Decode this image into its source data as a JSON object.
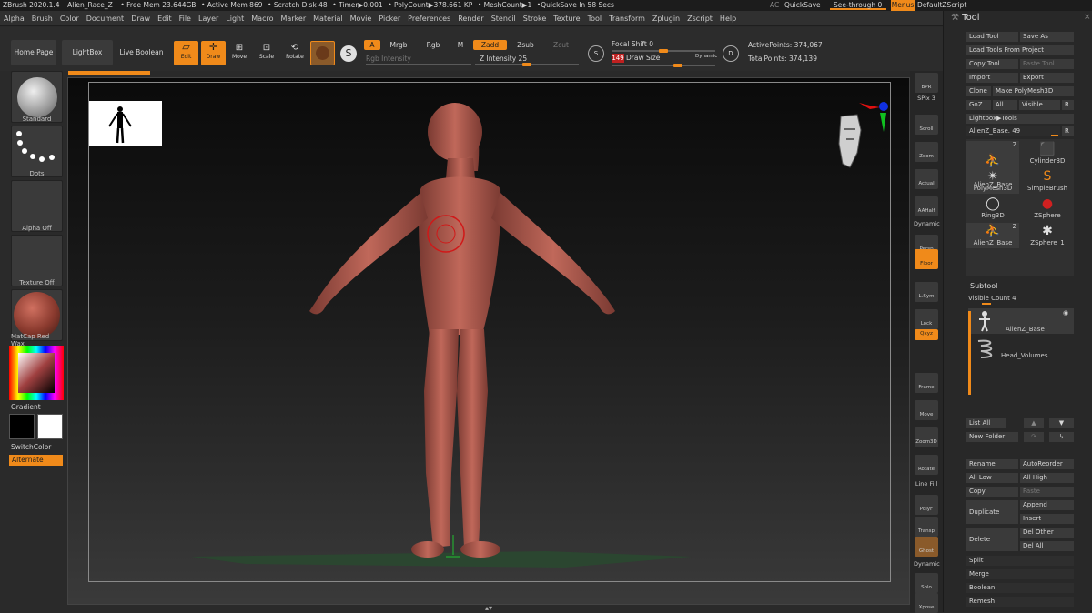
{
  "topbar": {
    "app": "ZBrush 2020.1.4",
    "file": "Alien_Race_Z",
    "free_mem": "• Free Mem 23.644GB",
    "active_mem": "• Active Mem 869",
    "scratch": "• Scratch Disk 48",
    "timer": "• Timer▶0.001",
    "polycount": "• PolyCount▶378.661 KP",
    "meshcount": "• MeshCount▶1",
    "quicksave_in": "•QuickSave In 58 Secs",
    "ac": "AC",
    "quicksave": "QuickSave",
    "see_through": "See-through  0",
    "menus": "Menus",
    "script": "DefaultZScript"
  },
  "menubar": [
    "Alpha",
    "Brush",
    "Color",
    "Document",
    "Draw",
    "Edit",
    "File",
    "Layer",
    "Light",
    "Macro",
    "Marker",
    "Material",
    "Movie",
    "Picker",
    "Preferences",
    "Render",
    "Stencil",
    "Stroke",
    "Texture",
    "Tool",
    "Transform",
    "Zplugin",
    "Zscript",
    "Help"
  ],
  "shelf": {
    "home_page": "Home Page",
    "lightbox": "LightBox",
    "live_boolean": "Live Boolean",
    "edit": "Edit",
    "draw": "Draw",
    "move": "Move",
    "scale": "Scale",
    "rotate": "Rotate",
    "a": "A",
    "mrgb": "Mrgb",
    "rgb": "Rgb",
    "m": "M",
    "zadd": "Zadd",
    "zsub": "Zsub",
    "zcut": "Zcut",
    "rgb_intensity": "Rgb Intensity",
    "z_intensity": "Z Intensity 25",
    "z_intensity_value": 25,
    "focal_shift": "Focal Shift 0",
    "draw_size_value": "149",
    "draw_size": "Draw Size",
    "dynamic": "Dynamic",
    "active_points": "ActivePoints: 374,067",
    "total_points": "TotalPoints: 374,139"
  },
  "lefttray": {
    "standard": "Standard",
    "dots": "Dots",
    "alpha_off": "Alpha Off",
    "texture_off": "Texture Off",
    "matcap": "MatCap Red Wax",
    "gradient": "Gradient",
    "switchcolor": "SwitchColor",
    "alternate": "Alternate"
  },
  "rightshelf": [
    "BPR",
    "SPix 3",
    "Scroll",
    "Zoom",
    "Actual",
    "AAHalf",
    "Dynamic",
    "Persp",
    "Floor",
    "L.Sym",
    "Lock",
    "Qxyz",
    "Frame",
    "Move",
    "Zoom3D",
    "Rotate",
    "Line Fill",
    "PolyF",
    "Transp",
    "Ghost",
    "Dynamic",
    "Solo",
    "Xpose"
  ],
  "toolpanel": {
    "title": "Tool",
    "load_tool": "Load Tool",
    "save_as": "Save As",
    "load_from_project": "Load Tools From Project",
    "copy_tool": "Copy Tool",
    "paste_tool": "Paste Tool",
    "import": "Import",
    "export": "Export",
    "clone": "Clone",
    "make_polymesh": "Make PolyMesh3D",
    "goz": "GoZ",
    "all": "All",
    "visible": "Visible",
    "r": "R",
    "lightbox_tools": "Lightbox▶Tools",
    "current_tool": "AlienZ_Base. 49",
    "tools": [
      {
        "name": "AlienZ_Base",
        "badge": "2"
      },
      {
        "name": "Cylinder3D",
        "badge": ""
      },
      {
        "name": "PolyMesh3D",
        "badge": ""
      },
      {
        "name": "SimpleBrush",
        "badge": ""
      },
      {
        "name": "Ring3D",
        "badge": ""
      },
      {
        "name": "ZSphere",
        "badge": ""
      },
      {
        "name": "AlienZ_Base",
        "badge": "2"
      },
      {
        "name": "ZSphere_1",
        "badge": ""
      }
    ],
    "subtool": "Subtool",
    "visible_count": "Visible Count 4",
    "subtools": [
      "AlienZ_Base",
      "Head_Volumes"
    ],
    "list_all": "List All",
    "new_folder": "New Folder",
    "rename": "Rename",
    "autoreorder": "AutoReorder",
    "all_low": "All Low",
    "all_high": "All High",
    "copy": "Copy",
    "paste": "Paste",
    "duplicate": "Duplicate",
    "append": "Append",
    "insert": "Insert",
    "delete": "Delete",
    "del_other": "Del Other",
    "del_all": "Del All",
    "split": "Split",
    "merge": "Merge",
    "boolean": "Boolean",
    "remesh": "Remesh"
  },
  "colors": {
    "accent": "#f08a1a",
    "model": "#b05a4e",
    "bg": "#2a2a2a"
  }
}
